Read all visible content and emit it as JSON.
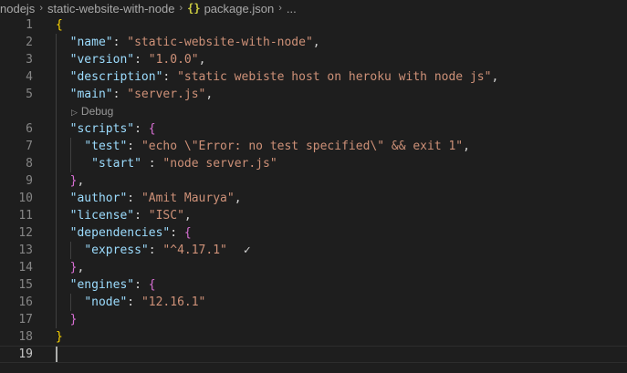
{
  "breadcrumb": {
    "items": [
      "nodejs",
      "static-website-with-node",
      "package.json",
      "..."
    ],
    "separator": "›",
    "file_icon": "{}"
  },
  "codelens": {
    "label": "Debug",
    "icon": "play-icon"
  },
  "editor": {
    "lines": [
      {
        "n": "1",
        "indent": "",
        "tokens": [
          {
            "c": "b1",
            "t": "{"
          }
        ]
      },
      {
        "n": "2",
        "indent": "  ",
        "tokens": [
          {
            "c": "k",
            "t": "\"name\""
          },
          {
            "c": "p",
            "t": ": "
          },
          {
            "c": "s",
            "t": "\"static-website-with-node\""
          },
          {
            "c": "p",
            "t": ","
          }
        ]
      },
      {
        "n": "3",
        "indent": "  ",
        "tokens": [
          {
            "c": "k",
            "t": "\"version\""
          },
          {
            "c": "p",
            "t": ": "
          },
          {
            "c": "s",
            "t": "\"1.0.0\""
          },
          {
            "c": "p",
            "t": ","
          }
        ]
      },
      {
        "n": "4",
        "indent": "  ",
        "tokens": [
          {
            "c": "k",
            "t": "\"description\""
          },
          {
            "c": "p",
            "t": ": "
          },
          {
            "c": "s",
            "t": "\"static webiste host on heroku with node js\""
          },
          {
            "c": "p",
            "t": ","
          }
        ]
      },
      {
        "n": "5",
        "indent": "  ",
        "tokens": [
          {
            "c": "k",
            "t": "\"main\""
          },
          {
            "c": "p",
            "t": ": "
          },
          {
            "c": "s",
            "t": "\"server.js\""
          },
          {
            "c": "p",
            "t": ","
          }
        ]
      },
      {
        "n": "6",
        "indent": "  ",
        "tokens": [
          {
            "c": "k",
            "t": "\"scripts\""
          },
          {
            "c": "p",
            "t": ": "
          },
          {
            "c": "b2",
            "t": "{"
          }
        ]
      },
      {
        "n": "7",
        "indent": "    ",
        "tokens": [
          {
            "c": "k",
            "t": "\"test\""
          },
          {
            "c": "p",
            "t": ": "
          },
          {
            "c": "s",
            "t": "\"echo \\\"Error: no test specified\\\" && exit 1\""
          },
          {
            "c": "p",
            "t": ","
          }
        ]
      },
      {
        "n": "8",
        "indent": "     ",
        "tokens": [
          {
            "c": "k",
            "t": "\"start\""
          },
          {
            "c": "p",
            "t": " : "
          },
          {
            "c": "s",
            "t": "\"node server.js\""
          }
        ]
      },
      {
        "n": "9",
        "indent": "  ",
        "tokens": [
          {
            "c": "b2",
            "t": "}"
          },
          {
            "c": "p",
            "t": ","
          }
        ]
      },
      {
        "n": "10",
        "indent": "  ",
        "tokens": [
          {
            "c": "k",
            "t": "\"author\""
          },
          {
            "c": "p",
            "t": ": "
          },
          {
            "c": "s",
            "t": "\"Amit Maurya\""
          },
          {
            "c": "p",
            "t": ","
          }
        ]
      },
      {
        "n": "11",
        "indent": "  ",
        "tokens": [
          {
            "c": "k",
            "t": "\"license\""
          },
          {
            "c": "p",
            "t": ": "
          },
          {
            "c": "s",
            "t": "\"ISC\""
          },
          {
            "c": "p",
            "t": ","
          }
        ]
      },
      {
        "n": "12",
        "indent": "  ",
        "tokens": [
          {
            "c": "k",
            "t": "\"dependencies\""
          },
          {
            "c": "p",
            "t": ": "
          },
          {
            "c": "b2",
            "t": "{"
          }
        ]
      },
      {
        "n": "13",
        "indent": "    ",
        "tokens": [
          {
            "c": "k",
            "t": "\"express\""
          },
          {
            "c": "p",
            "t": ": "
          },
          {
            "c": "s",
            "t": "\"^4.17.1\""
          },
          {
            "c": "check",
            "t": "✓"
          }
        ]
      },
      {
        "n": "14",
        "indent": "  ",
        "tokens": [
          {
            "c": "b2",
            "t": "}"
          },
          {
            "c": "p",
            "t": ","
          }
        ]
      },
      {
        "n": "15",
        "indent": "  ",
        "tokens": [
          {
            "c": "k",
            "t": "\"engines\""
          },
          {
            "c": "p",
            "t": ": "
          },
          {
            "c": "b2",
            "t": "{"
          }
        ]
      },
      {
        "n": "16",
        "indent": "    ",
        "tokens": [
          {
            "c": "k",
            "t": "\"node\""
          },
          {
            "c": "p",
            "t": ": "
          },
          {
            "c": "s",
            "t": "\"12.16.1\""
          }
        ]
      },
      {
        "n": "17",
        "indent": "  ",
        "tokens": [
          {
            "c": "b2",
            "t": "}"
          }
        ]
      },
      {
        "n": "18",
        "indent": "",
        "tokens": [
          {
            "c": "b1",
            "t": "}"
          }
        ]
      },
      {
        "n": "19",
        "indent": "",
        "tokens": []
      }
    ]
  },
  "colors": {
    "background": "#1e1e1e",
    "key": "#9cdcfe",
    "string": "#ce9178",
    "bracket_level1": "#ffd700",
    "bracket_level2": "#da70d6",
    "line_number": "#858585",
    "json_icon": "#cbcb41"
  }
}
